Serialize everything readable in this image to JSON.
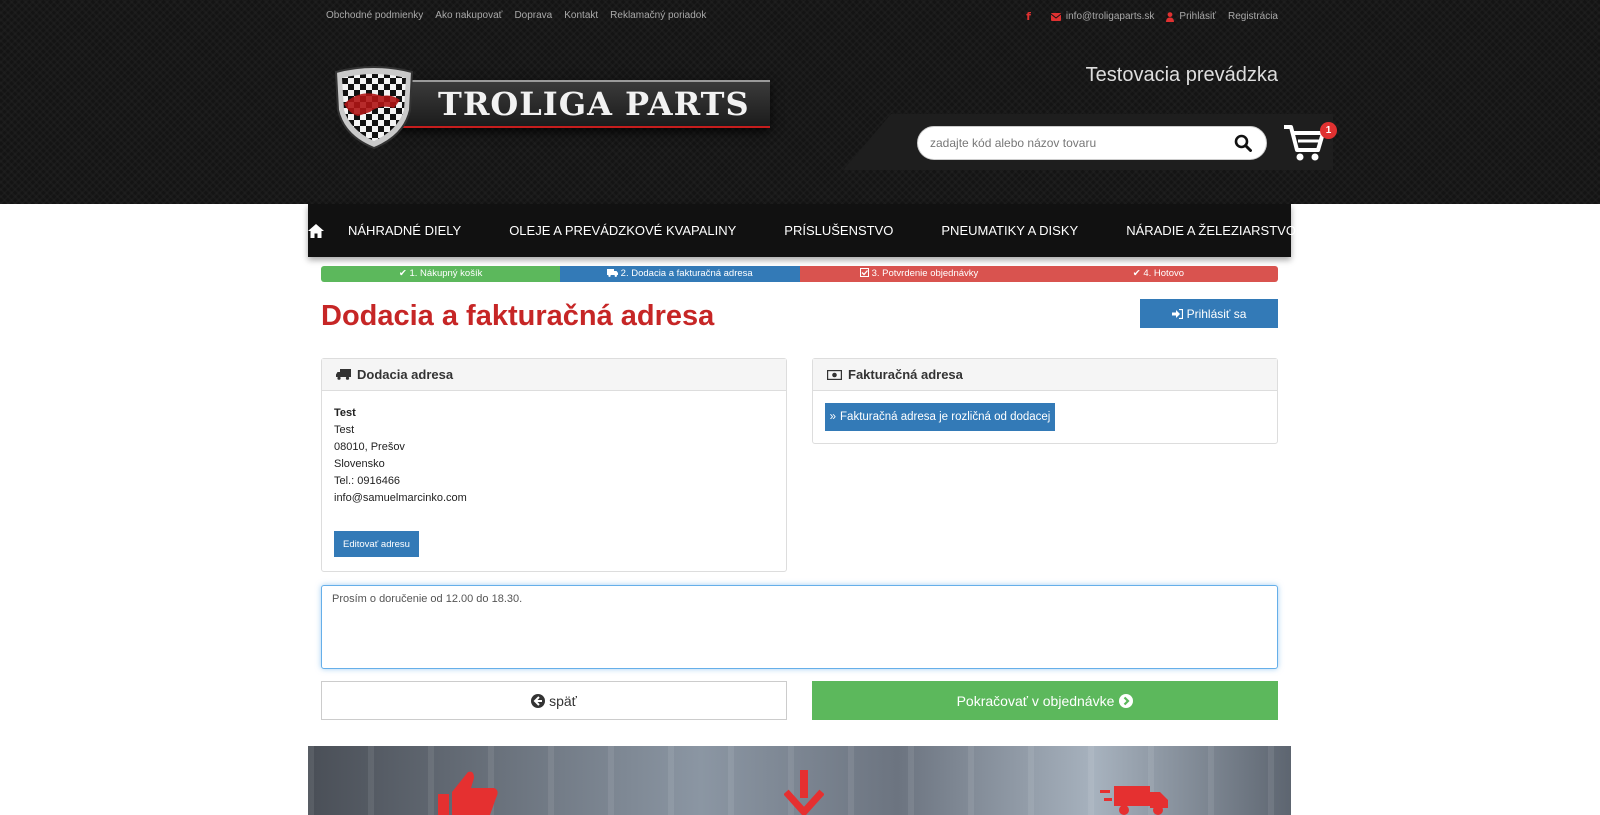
{
  "top_links": [
    "Obchodné podmienky",
    "Ako nakupovať",
    "Doprava",
    "Kontakt",
    "Reklamačný poriadok"
  ],
  "top_right": {
    "facebook_icon": "facebook-icon",
    "email": "info@troligaparts.sk",
    "login": "Prihlásiť",
    "register": "Registrácia"
  },
  "logo": {
    "text": "TROLIGA PARTS"
  },
  "header": {
    "env_label": "Testovacia prevádzka"
  },
  "search": {
    "placeholder": "zadajte kód alebo názov tovaru"
  },
  "cart": {
    "count": "1"
  },
  "nav": {
    "items": [
      "NÁHRADNÉ DIELY",
      "OLEJE A PREVÁDZKOVÉ KVAPALINY",
      "PRÍSLUŠENSTVO",
      "PNEUMATIKY A DISKY",
      "NÁRADIE A ŽELEZIARSTVO"
    ]
  },
  "steps": [
    {
      "label": "1. Nákupný košík",
      "status": "done",
      "color": "#5cb85c"
    },
    {
      "label": "2. Dodacia a fakturačná adresa",
      "status": "current",
      "color": "#337ab7"
    },
    {
      "label": "3. Potvrdenie objednávky",
      "status": "pending",
      "color": "#d9534f"
    },
    {
      "label": "4. Hotovo",
      "status": "pending",
      "color": "#d9534f"
    }
  ],
  "page": {
    "title": "Dodacia a fakturačná adresa",
    "login_button": "Prihlásiť sa"
  },
  "delivery": {
    "heading": "Dodacia adresa",
    "name": "Test",
    "street": "Test",
    "city": "08010, Prešov",
    "country": "Slovensko",
    "phone": "Tel.: 0916466",
    "email": "info@samuelmarcinko.com",
    "edit_button": "Editovať adresu"
  },
  "billing": {
    "heading": "Fakturačná adresa",
    "different_button": "Fakturačná adresa je rozličná od dodacej"
  },
  "note": {
    "value": "Prosím o doručenie od 12.00 do 18.30."
  },
  "actions": {
    "back": "späť",
    "continue": "Pokračovať v objednávke"
  },
  "colors": {
    "brand_red": "#c62626",
    "primary_blue": "#337ab7",
    "success_green": "#5cb85c",
    "danger_red": "#d9534f"
  }
}
